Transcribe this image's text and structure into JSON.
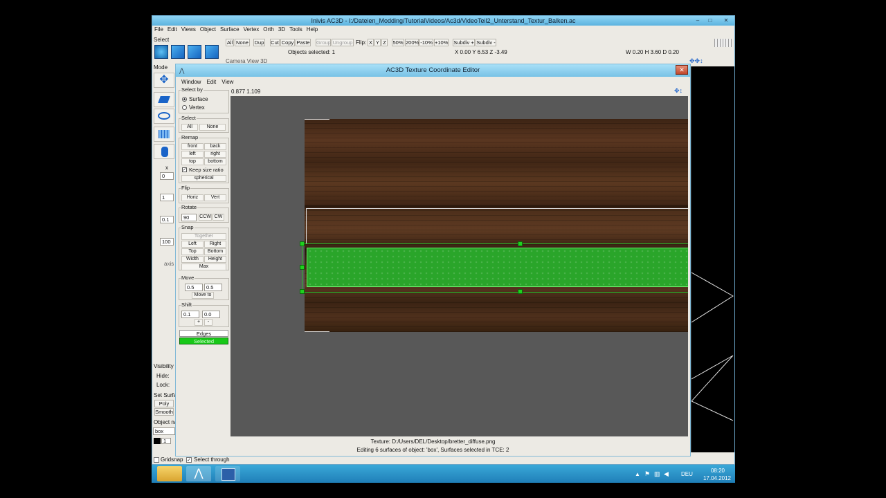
{
  "app": {
    "title": "Inivis AC3D - I:/Dateien_Modding/TutorialVideos/Ac3d/VideoTeil2_Unterstand_Textur_Balken.ac",
    "menu": [
      "File",
      "Edit",
      "Views",
      "Object",
      "Surface",
      "Vertex",
      "Orth",
      "3D",
      "Tools",
      "Help"
    ],
    "window_buttons": [
      "–",
      "□",
      "✕"
    ]
  },
  "toolbar": {
    "select_label": "Select",
    "buttons": [
      "All",
      "None",
      "Dup",
      "Cut",
      "Copy",
      "Paste",
      "Group",
      "Ungroup"
    ],
    "disabled": [
      "Group",
      "Ungroup"
    ],
    "flip_label": "Flip:",
    "flip_axes": [
      "X",
      "Y",
      "Z"
    ],
    "scale_buttons": [
      "50%",
      "200%",
      "-10%",
      "+10%"
    ],
    "subdiv_plus": "Subdiv +",
    "subdiv_minus": "Subdiv -",
    "objects_selected": "Objects selected: 1",
    "coords": "X 0.00 Y 6.53 Z -3.49",
    "dims": "W 0.20 H 3.60 D 0.20",
    "camera_view": "Camera View 3D"
  },
  "left_panel": {
    "mode_label": "Mode",
    "x_label": "x",
    "fields": [
      "0",
      "1",
      "0.1",
      "100"
    ],
    "axis_label": "axis",
    "visibility_label": "Visibility",
    "hide_label": "Hide:",
    "lock_label": "Lock:",
    "set_surface_label": "Set Surfa",
    "poly": "Poly",
    "smooth": "Smooth",
    "object_name_label": "Object na",
    "object_name": "box",
    "layer_value": "1",
    "gridsnap": "Gridsnap",
    "select_through": "Select through"
  },
  "tce": {
    "title": "AC3D Texture Coordinate Editor",
    "menu": [
      "Window",
      "Edit",
      "View"
    ],
    "coords": "0.877 1.109",
    "select_by": {
      "label": "Select by",
      "options": [
        "Surface",
        "Vertex"
      ],
      "selected": "Surface"
    },
    "select": {
      "label": "Select",
      "all": "All",
      "none": "None"
    },
    "remap": {
      "label": "Remap",
      "buttons": [
        "front",
        "back",
        "left",
        "right",
        "top",
        "bottom"
      ],
      "keep_size_ratio": "Keep size ratio",
      "spherical": "spherical"
    },
    "flip": {
      "label": "Flip",
      "horiz": "Horiz",
      "vert": "Vert"
    },
    "rotate": {
      "label": "Rotate",
      "value": "90",
      "ccw": "CCW",
      "cw": "CW"
    },
    "snap": {
      "label": "Snap",
      "together": "Together",
      "left": "Left",
      "right": "Right",
      "top": "Top",
      "bottom": "Bottom",
      "width": "Width",
      "height": "Height",
      "max": "Max"
    },
    "move": {
      "label": "Move",
      "x": "0.5",
      "y": "0.5",
      "move_to": "Move to"
    },
    "shift": {
      "label": "Shift",
      "x": "0.1",
      "y": "0.0",
      "plus": "+",
      "minus": "-"
    },
    "legend": {
      "edges": "Edges",
      "selected": "Selected"
    },
    "texture_path": "Texture: D:/Users/DEL/Desktop/bretter_diffuse.png",
    "status": "Editing 6 surfaces of object: 'box', Surfaces selected in TCE: 2"
  },
  "taskbar": {
    "lang": "DEU",
    "time": "08:20",
    "date": "17.04.2012",
    "tray_icons": [
      "up-arrow-icon",
      "flag-icon",
      "network-icon",
      "volume-icon"
    ]
  },
  "colors": {
    "titlebar": "#78c2e6",
    "selected_green": "#2aa52a",
    "taskbar": "#1f7fb8"
  }
}
